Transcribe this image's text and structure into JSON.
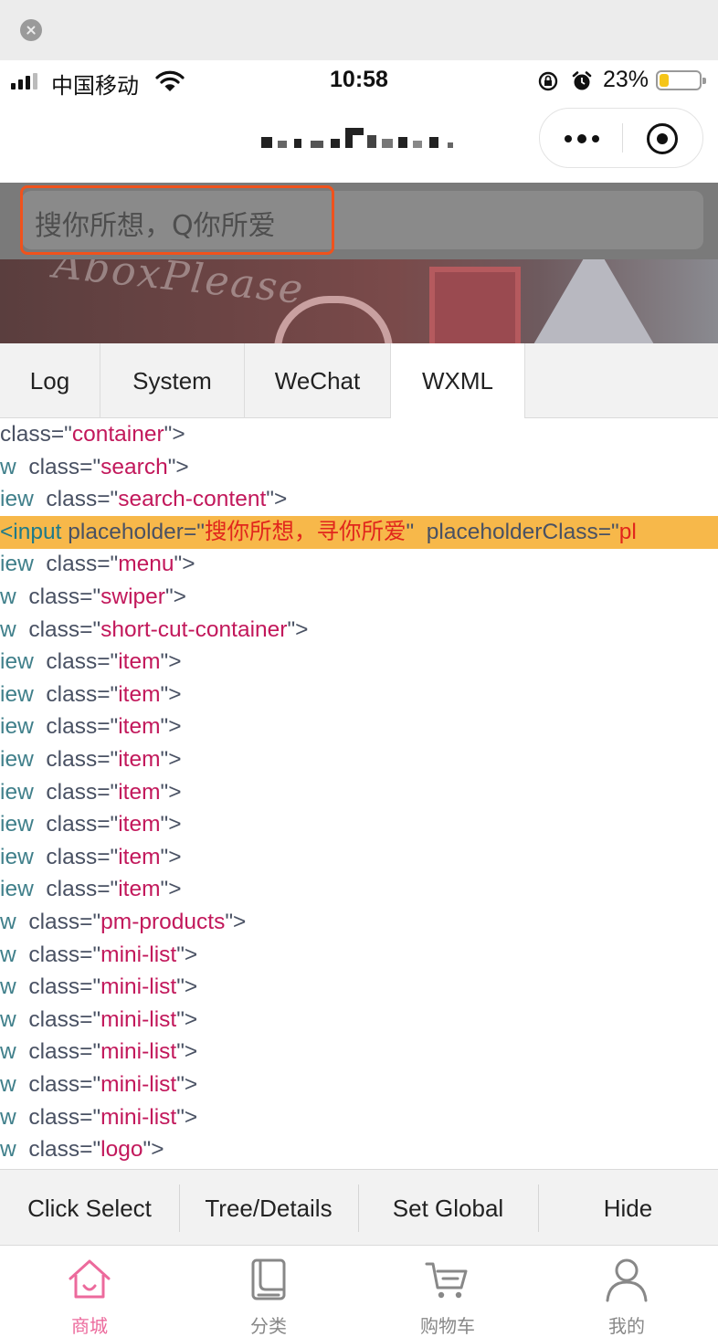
{
  "status_bar": {
    "carrier": "中国移动",
    "time": "10:58",
    "battery_percent": "23%",
    "battery_level": 0.23
  },
  "search": {
    "placeholder": "搜你所想，Q你所爱"
  },
  "banner": {
    "watermark": "AboxPlease"
  },
  "debug_tabs": [
    {
      "label": "Log"
    },
    {
      "label": "System"
    },
    {
      "label": "WeChat"
    },
    {
      "label": "WXML",
      "active": true
    }
  ],
  "wxml_lines": [
    {
      "tag": "",
      "attr": "class",
      "value": "container"
    },
    {
      "tag": "w",
      "attr": "class",
      "value": "search"
    },
    {
      "tag": "iew",
      "attr": "class",
      "value": "search-content"
    },
    {
      "tag": "<input",
      "attr": "placeholder",
      "value": "搜你所想，寻你所爱",
      "extra_attr": "placeholderClass",
      "extra_value": "pl",
      "highlight": true
    },
    {
      "tag": "iew",
      "attr": "class",
      "value": "menu"
    },
    {
      "tag": "w",
      "attr": "class",
      "value": "swiper"
    },
    {
      "tag": "w",
      "attr": "class",
      "value": "short-cut-container"
    },
    {
      "tag": "iew",
      "attr": "class",
      "value": "item"
    },
    {
      "tag": "iew",
      "attr": "class",
      "value": "item"
    },
    {
      "tag": "iew",
      "attr": "class",
      "value": "item"
    },
    {
      "tag": "iew",
      "attr": "class",
      "value": "item"
    },
    {
      "tag": "iew",
      "attr": "class",
      "value": "item"
    },
    {
      "tag": "iew",
      "attr": "class",
      "value": "item"
    },
    {
      "tag": "iew",
      "attr": "class",
      "value": "item"
    },
    {
      "tag": "iew",
      "attr": "class",
      "value": "item"
    },
    {
      "tag": "w",
      "attr": "class",
      "value": "pm-products"
    },
    {
      "tag": "w",
      "attr": "class",
      "value": "mini-list"
    },
    {
      "tag": "w",
      "attr": "class",
      "value": "mini-list"
    },
    {
      "tag": "w",
      "attr": "class",
      "value": "mini-list"
    },
    {
      "tag": "w",
      "attr": "class",
      "value": "mini-list"
    },
    {
      "tag": "w",
      "attr": "class",
      "value": "mini-list"
    },
    {
      "tag": "w",
      "attr": "class",
      "value": "mini-list"
    },
    {
      "tag": "w",
      "attr": "class",
      "value": "logo"
    }
  ],
  "actions": [
    {
      "label": "Click Select"
    },
    {
      "label": "Tree/Details"
    },
    {
      "label": "Set Global"
    },
    {
      "label": "Hide"
    }
  ],
  "tabbar": [
    {
      "label": "商城",
      "icon": "home-icon",
      "active": true
    },
    {
      "label": "分类",
      "icon": "category-icon",
      "active": false
    },
    {
      "label": "购物车",
      "icon": "cart-icon",
      "active": false
    },
    {
      "label": "我的",
      "icon": "user-icon",
      "active": false
    }
  ],
  "colors": {
    "accent_pink": "#ec6a9c",
    "highlight_orange": "#f7b84a",
    "selection_border": "#f0521c",
    "attr_value": "#c2185b"
  }
}
